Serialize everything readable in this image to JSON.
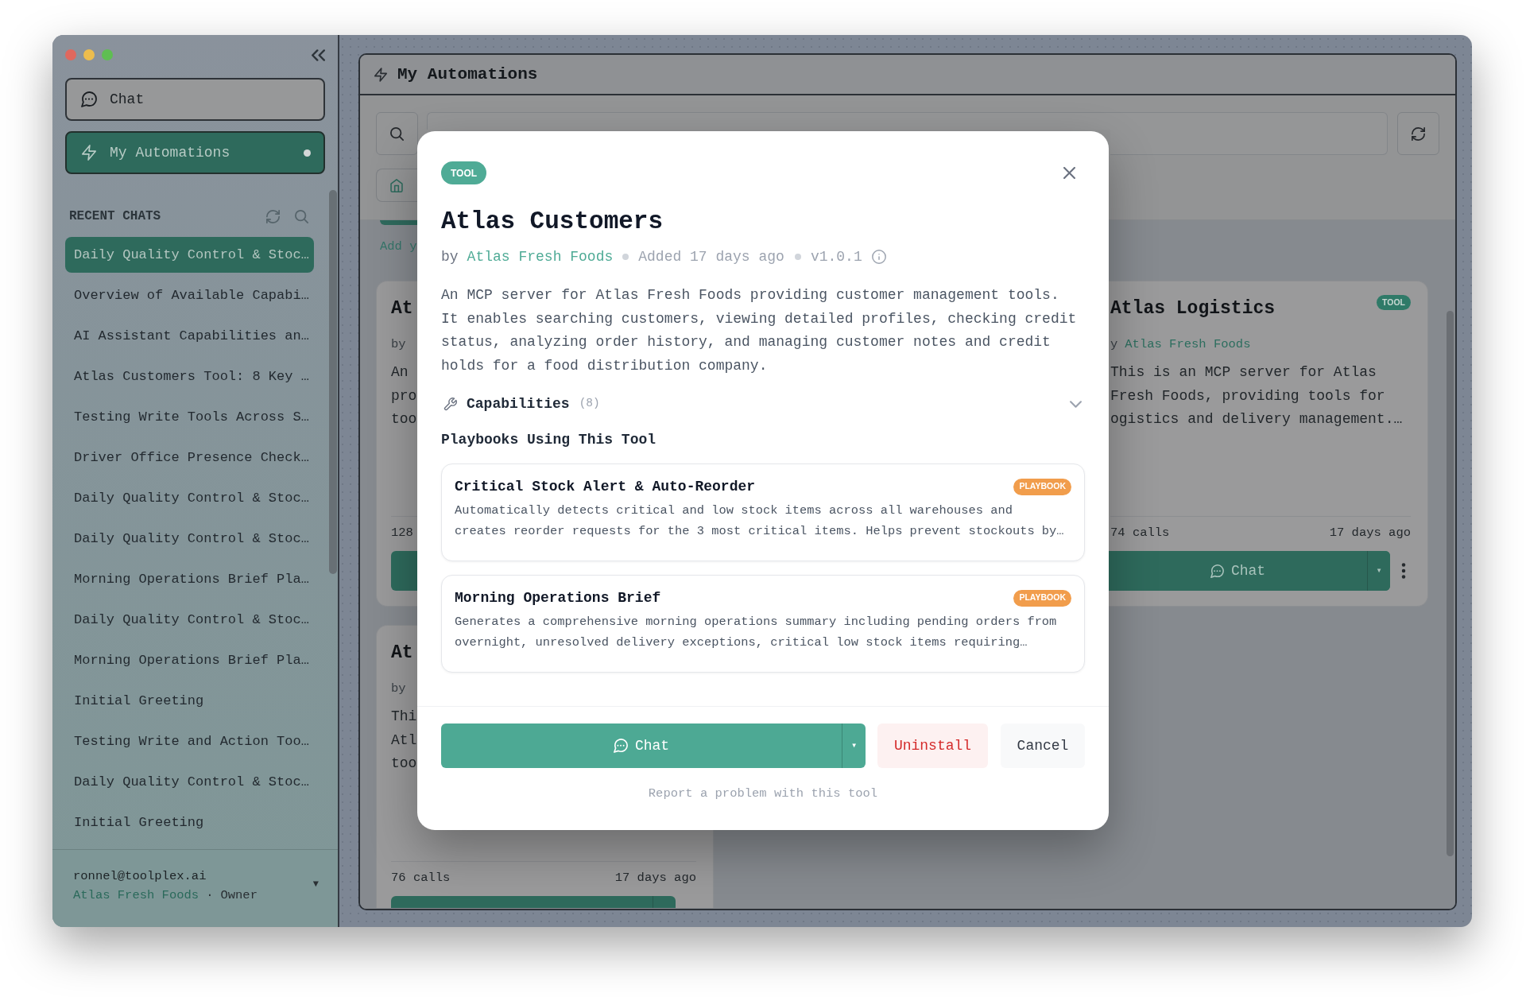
{
  "sidebar": {
    "nav": [
      {
        "label": "Chat",
        "selected": false,
        "dot": false
      },
      {
        "label": "My Automations",
        "selected": true,
        "dot": true
      }
    ],
    "recent_chats": {
      "title": "RECENT CHATS",
      "items": [
        {
          "label": "Daily Quality Control & Stoc…",
          "selected": true
        },
        {
          "label": "Overview of Available Capabi…",
          "selected": false
        },
        {
          "label": "AI Assistant Capabilities an…",
          "selected": false
        },
        {
          "label": "Atlas Customers Tool: 8 Key …",
          "selected": false
        },
        {
          "label": "Testing Write Tools Across S…",
          "selected": false
        },
        {
          "label": "Driver Office Presence Check…",
          "selected": false
        },
        {
          "label": "Daily Quality Control & Stoc…",
          "selected": false
        },
        {
          "label": "Daily Quality Control & Stoc…",
          "selected": false
        },
        {
          "label": "Morning Operations Brief Pla…",
          "selected": false
        },
        {
          "label": "Daily Quality Control & Stoc…",
          "selected": false
        },
        {
          "label": "Morning Operations Brief Pla…",
          "selected": false
        },
        {
          "label": "Initial Greeting",
          "selected": false
        },
        {
          "label": "Testing Write and Action Too…",
          "selected": false
        },
        {
          "label": "Daily Quality Control & Stoc…",
          "selected": false
        },
        {
          "label": "Initial Greeting",
          "selected": false
        }
      ]
    },
    "account": {
      "email": "ronnel@toolplex.ai",
      "organization": "Atlas Fresh Foods",
      "separator": "·",
      "role": "Owner",
      "caret": "▼"
    }
  },
  "main": {
    "header": {
      "title": "My Automations"
    },
    "notice": "Add y",
    "cards": [
      {
        "title": "At",
        "byline": "by",
        "description": [
          "An",
          "pro",
          "too"
        ],
        "calls": "128"
      },
      {
        "badge": "TOOL",
        "title": "Atlas Logistics",
        "byline": "y",
        "author": "Atlas Fresh Foods",
        "description": [
          "This is an MCP server for Atlas",
          "Fresh Foods, providing tools for",
          "ogistics and delivery management.…"
        ],
        "calls": "74 calls",
        "updated": "17 days ago",
        "action": "Chat",
        "caret": "▾",
        "menu": true
      },
      {
        "title": "At",
        "byline": "by",
        "description": [
          "Thi",
          "Atl",
          "too"
        ],
        "calls": "76 calls",
        "updated": "17 days ago"
      }
    ]
  },
  "modal": {
    "badge": "TOOL",
    "title": "Atlas Customers",
    "byline": {
      "prefix": "by",
      "author": "Atlas Fresh Foods",
      "added": "Added 17 days ago",
      "version": "v1.0.1"
    },
    "description": "An MCP server for Atlas Fresh Foods providing customer management tools. It enables searching customers, viewing detailed profiles, checking credit status, analyzing order history, and managing customer notes and credit holds for a food distribution company.",
    "capabilities": {
      "label": "Capabilities",
      "count": "(8)",
      "expanded": false
    },
    "playbooks": {
      "title": "Playbooks Using This Tool",
      "items": [
        {
          "title": "Critical Stock Alert & Auto-Reorder",
          "badge": "PLAYBOOK",
          "description": "Automatically detects critical and low stock items across all warehouses and creates reorder requests for the 3 most critical items. Helps prevent stockouts by…"
        },
        {
          "title": "Morning Operations Brief",
          "badge": "PLAYBOOK",
          "description": "Generates a comprehensive morning operations summary including pending orders from overnight, unresolved delivery exceptions, critical low stock items requiring…"
        }
      ]
    },
    "actions": {
      "chat": "Chat",
      "caret": "▾",
      "uninstall": "Uninstall",
      "cancel": "Cancel"
    },
    "report_link": "Report a problem with this tool"
  }
}
